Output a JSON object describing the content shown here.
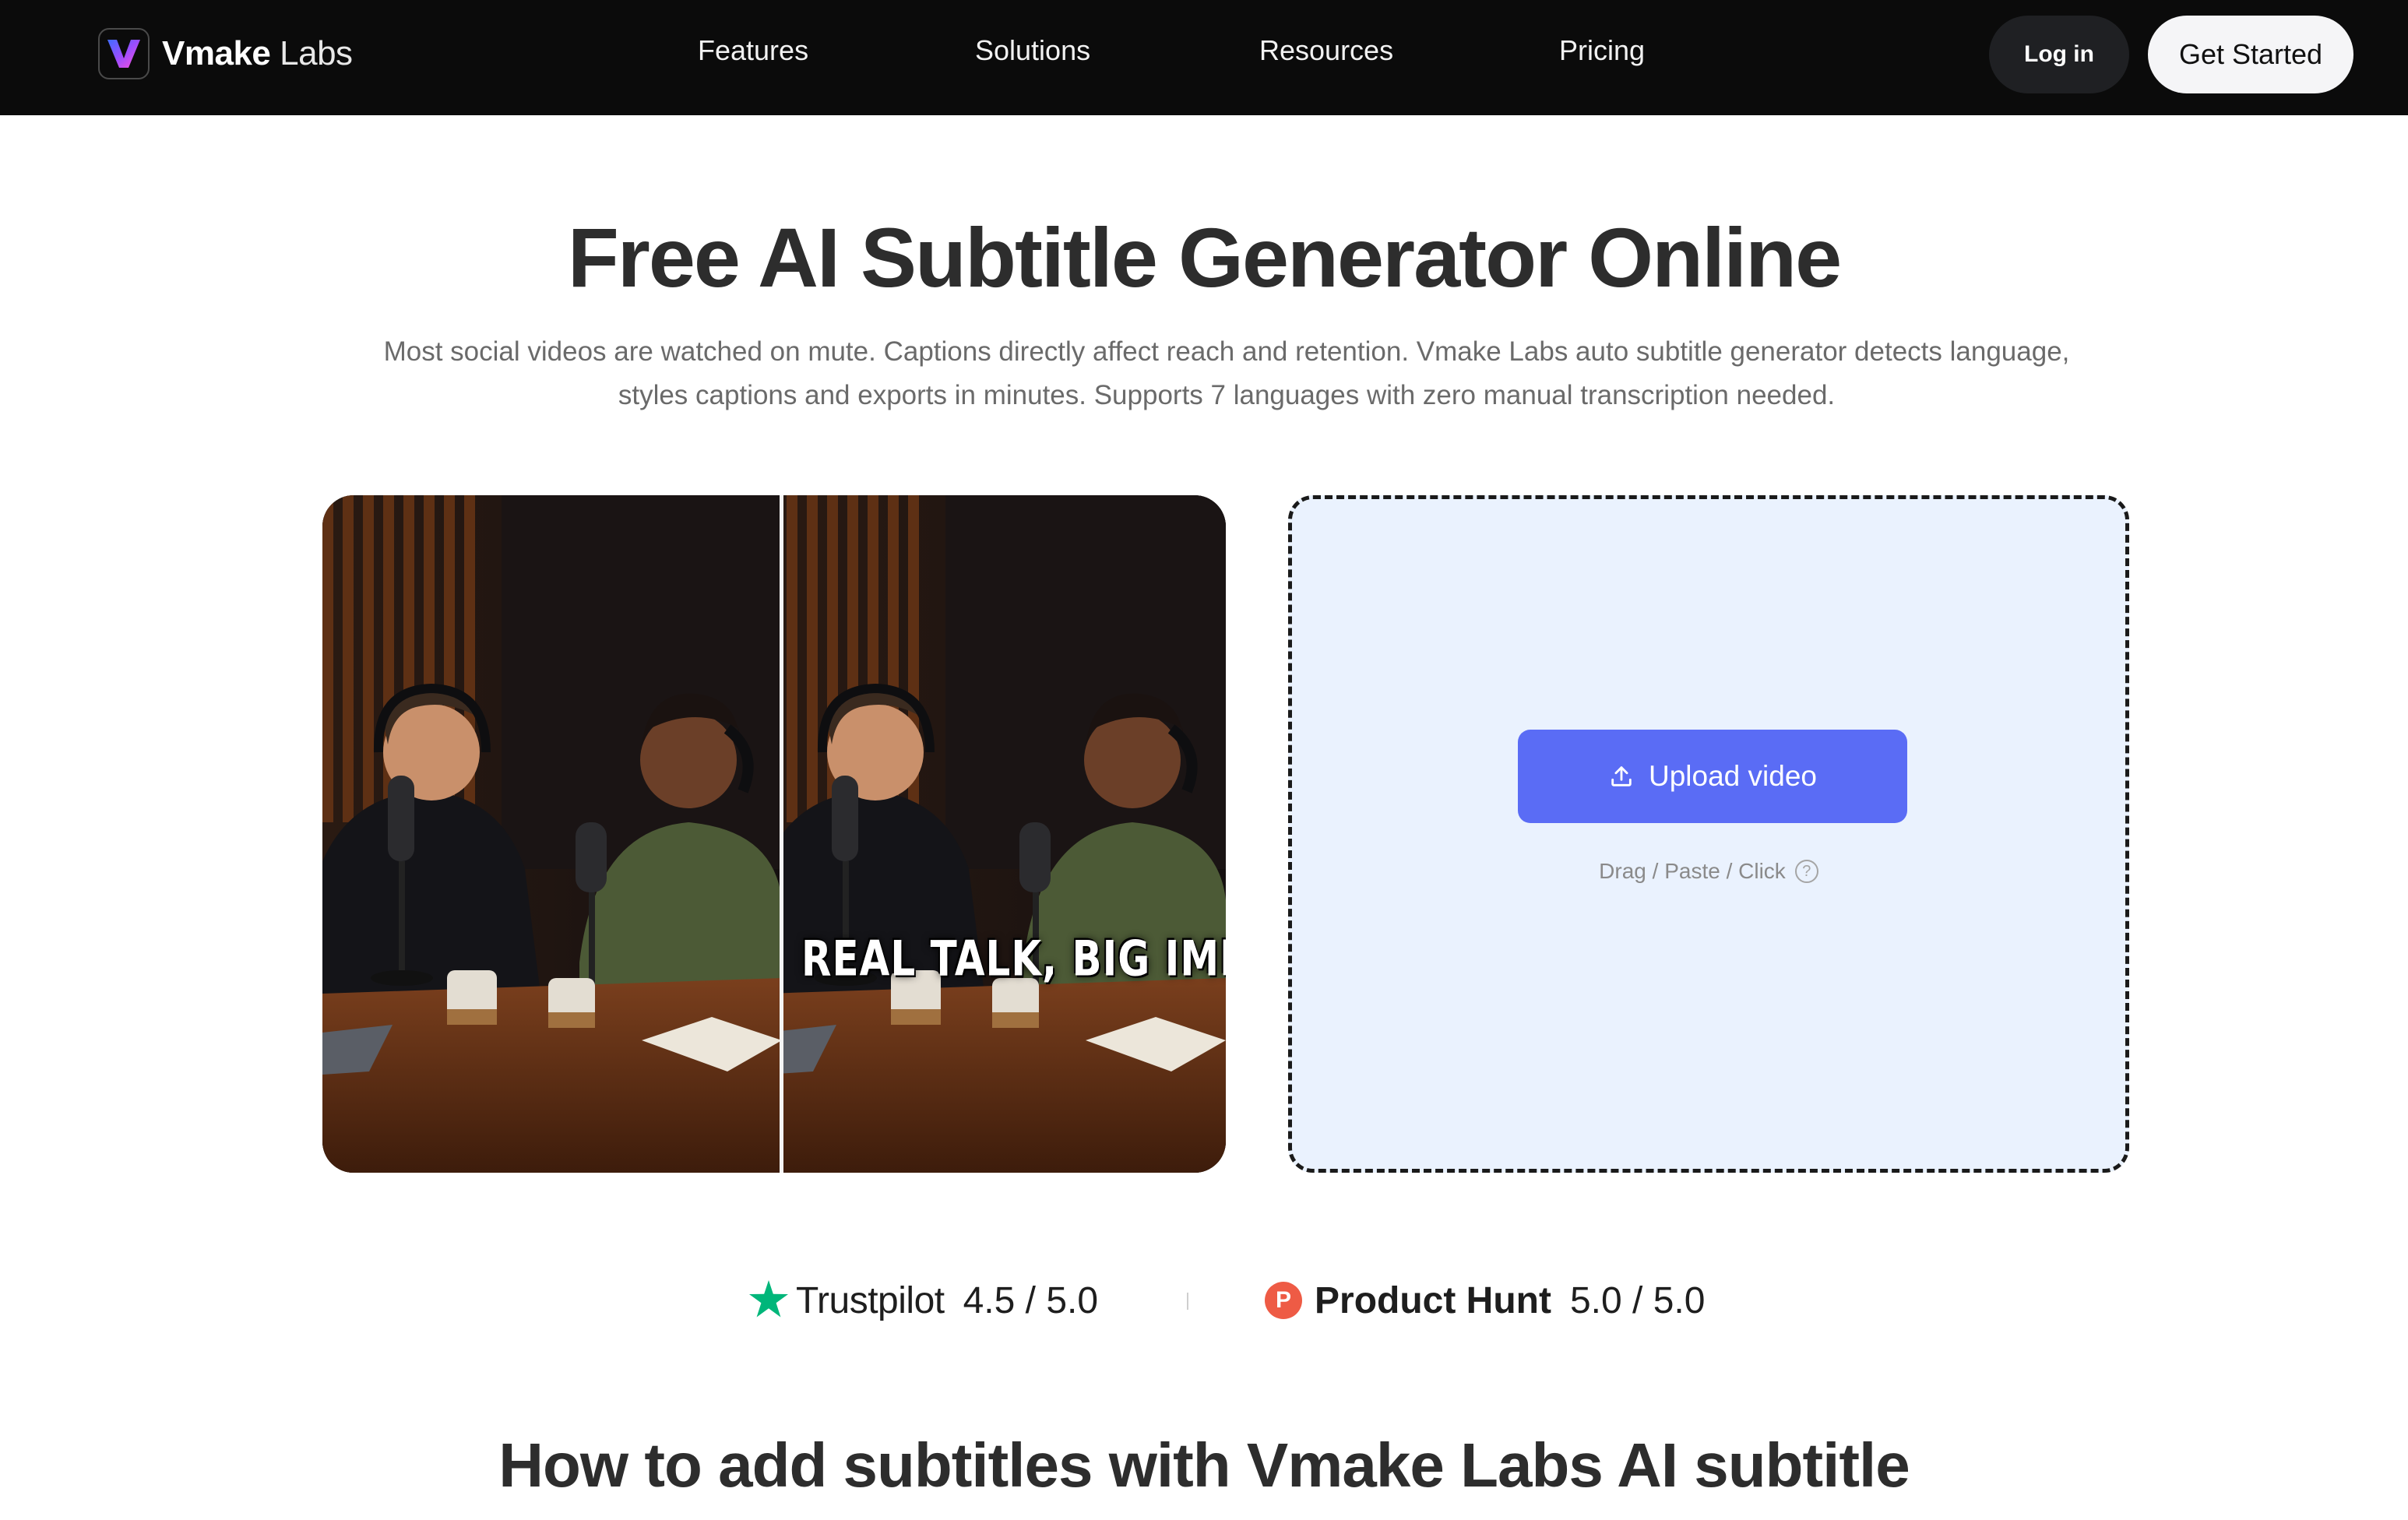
{
  "brand": {
    "name_bold": "Vmake",
    "name_light": "Labs"
  },
  "nav": {
    "items": [
      {
        "label": "Features"
      },
      {
        "label": "Solutions"
      },
      {
        "label": "Resources"
      },
      {
        "label": "Pricing"
      }
    ],
    "login_label": "Log in",
    "get_started_label": "Get Started"
  },
  "hero": {
    "title": "Free AI Subtitle Generator Online",
    "subtitle_line1": "Most social videos are watched on mute. Captions directly affect reach and retention. Vmake Labs auto subtitle generator detects language,",
    "subtitle_line2": "styles captions and exports in minutes. Supports 7 languages with zero manual transcription needed."
  },
  "preview": {
    "caption": "REAL TALK, BIG IMPACT"
  },
  "upload": {
    "button_label": "Upload video",
    "hint": "Drag / Paste / Click",
    "help_glyph": "?"
  },
  "ratings": {
    "trustpilot": {
      "name": "Trustpilot",
      "score": "4.5 / 5.0"
    },
    "producthunt": {
      "badge": "P",
      "name": "Product Hunt",
      "score": "5.0 / 5.0"
    }
  },
  "how_to": {
    "title": "How to add subtitles with Vmake Labs AI subtitle"
  },
  "colors": {
    "topbar": "#0b0b0b",
    "upload_button": "#5a6cf5",
    "dropzone_bg": "#eaf2fe",
    "trustpilot_green": "#00b67a",
    "producthunt_red": "#ee5b45"
  },
  "icons": [
    "vmake-logo-icon",
    "upload-icon",
    "help-icon",
    "trustpilot-star-icon",
    "producthunt-badge-icon"
  ]
}
